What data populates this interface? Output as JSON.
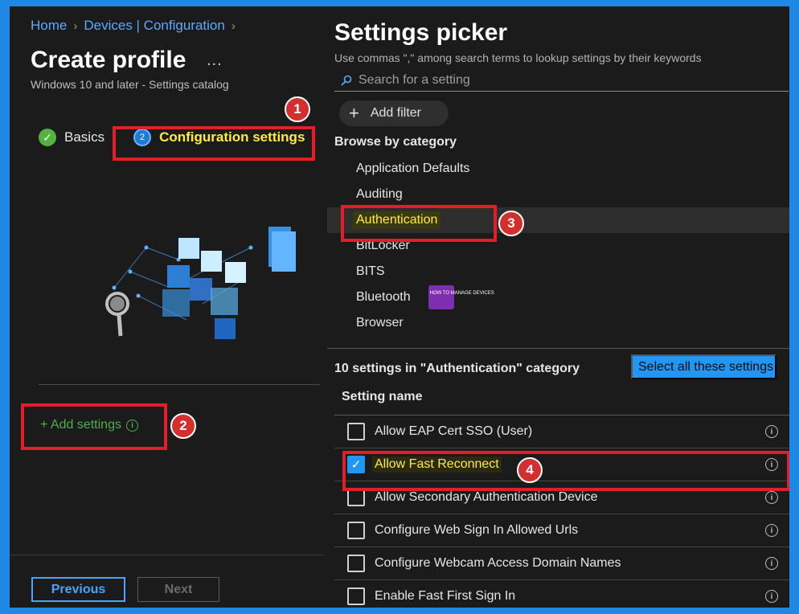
{
  "breadcrumb": [
    "Home",
    "Devices | Configuration"
  ],
  "left": {
    "title": "Create profile",
    "more": "...",
    "subtitle": "Windows 10 and later - Settings catalog",
    "steps": [
      {
        "label": "Basics",
        "state": "completed"
      },
      {
        "label": "Configuration settings",
        "number": "2",
        "state": "active"
      }
    ],
    "add_settings": "+ Add settings",
    "previous": "Previous",
    "next": "Next"
  },
  "picker": {
    "title": "Settings picker",
    "help": "Use commas \",\" among search terms to lookup settings by their keywords",
    "search_placeholder": "Search for a setting",
    "add_filter": "Add filter",
    "browse_title": "Browse by category",
    "categories": [
      "Application Defaults",
      "Auditing",
      "Authentication",
      "BitLocker",
      "BITS",
      "Bluetooth",
      "Browser"
    ],
    "selected_category": "Authentication",
    "count_text": "10 settings in \"Authentication\" category",
    "select_all": "Select all these settings",
    "column_header": "Setting name",
    "settings": [
      {
        "label": "Allow EAP Cert SSO (User)",
        "checked": false
      },
      {
        "label": "Allow Fast Reconnect",
        "checked": true
      },
      {
        "label": "Allow Secondary Authentication Device",
        "checked": false
      },
      {
        "label": "Configure Web Sign In Allowed Urls",
        "checked": false
      },
      {
        "label": "Configure Webcam Access Domain Names",
        "checked": false
      },
      {
        "label": "Enable Fast First Sign In",
        "checked": false
      }
    ]
  },
  "annotations": [
    "1",
    "2",
    "3",
    "4"
  ],
  "colors": {
    "accent": "#2196f3",
    "highlight": "#ffeb3b",
    "callout": "#e41e26",
    "success": "#54b33e"
  }
}
